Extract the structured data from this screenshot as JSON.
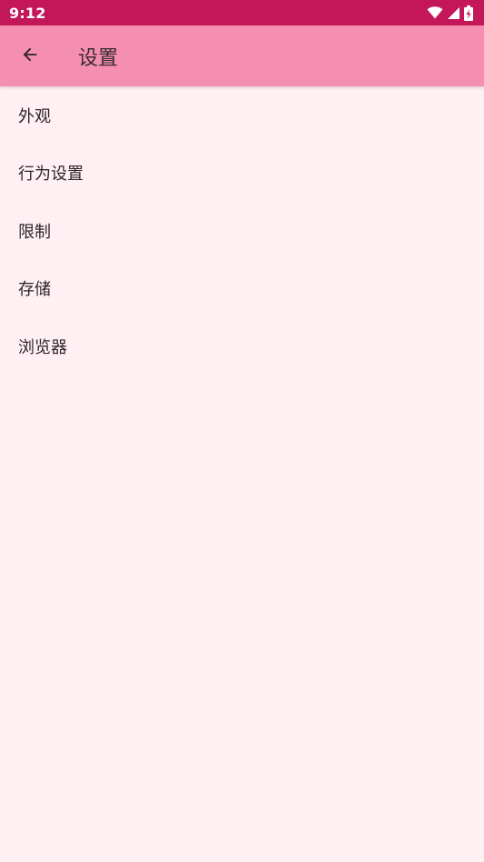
{
  "status_bar": {
    "time": "9:12",
    "icons": [
      "wifi-icon",
      "cellular-signal-icon",
      "battery-charging-icon"
    ]
  },
  "app_bar": {
    "back_icon": "arrow-left-icon",
    "title": "设置"
  },
  "settings": {
    "items": [
      {
        "label": "外观"
      },
      {
        "label": "行为设置"
      },
      {
        "label": "限制"
      },
      {
        "label": "存储"
      },
      {
        "label": "浏览器"
      }
    ]
  },
  "colors": {
    "status_bar": "#c4175a",
    "app_bar": "#f48fb1",
    "background": "#fff0f4",
    "text": "#2e2528"
  }
}
